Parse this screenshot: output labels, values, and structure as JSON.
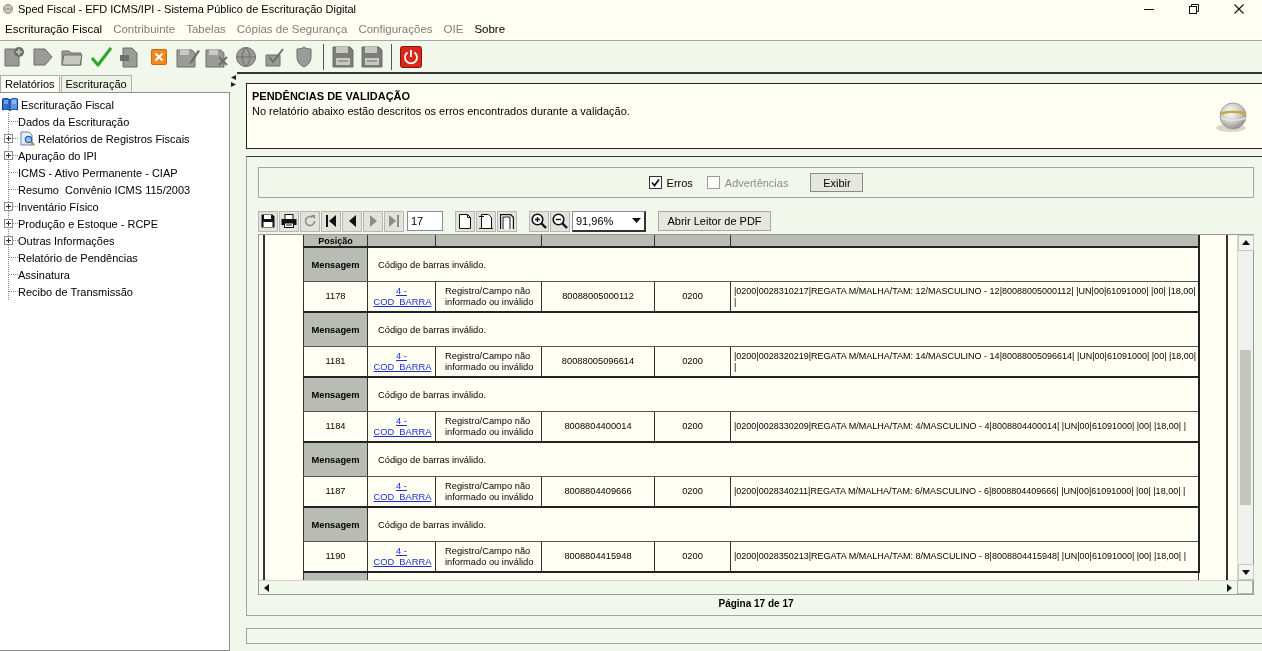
{
  "window": {
    "title": "Sped Fiscal - EFD ICMS/IPI - Sistema Público de Escrituração Digital"
  },
  "menu": [
    {
      "label": "Escrituração Fiscal",
      "disabled": false
    },
    {
      "label": "Contribuinte",
      "disabled": true
    },
    {
      "label": "Tabelas",
      "disabled": true
    },
    {
      "label": "Cópias de Segurança",
      "disabled": true
    },
    {
      "label": "Configurações",
      "disabled": true
    },
    {
      "label": "OIE",
      "disabled": true
    },
    {
      "label": "Sobre",
      "disabled": false
    }
  ],
  "toolbar": [
    {
      "buttons": [
        {
          "kind": "page-plus",
          "disabled": true
        },
        {
          "kind": "page-arrow",
          "disabled": true
        },
        {
          "kind": "folder",
          "disabled": true
        },
        {
          "kind": "check",
          "disabled": false
        },
        {
          "kind": "page",
          "disabled": true
        },
        {
          "kind": "x-box",
          "disabled": false
        },
        {
          "kind": "floppy-pen",
          "disabled": true
        },
        {
          "kind": "floppy-x",
          "disabled": true
        },
        {
          "kind": "globe",
          "disabled": true
        },
        {
          "kind": "tray-check",
          "disabled": true
        },
        {
          "kind": "shield",
          "disabled": true
        }
      ]
    },
    {
      "buttons": [
        {
          "kind": "floppy",
          "disabled": true
        },
        {
          "kind": "floppy",
          "disabled": true
        }
      ]
    },
    {
      "buttons": [
        {
          "kind": "power",
          "disabled": false
        }
      ]
    }
  ],
  "sidebar": {
    "tabs": [
      {
        "label": "Relatórios",
        "selected": true
      },
      {
        "label": "Escrituração",
        "selected": false
      }
    ],
    "tree": [
      {
        "label": "Escrituração Fiscal",
        "kind": "book",
        "children": [
          {
            "label": "Dados da Escrituração",
            "kind": "leaf"
          },
          {
            "label": "Relatórios de Registros Fiscais",
            "kind": "report",
            "expanded": false
          },
          {
            "label": "Apuração do IPI",
            "kind": "branch",
            "expanded": false
          },
          {
            "label": "ICMS - Ativo Permanente - CIAP",
            "kind": "leaf"
          },
          {
            "label": "Resumo  Convênio ICMS 115/2003",
            "kind": "leaf"
          },
          {
            "label": "Inventário Físico",
            "kind": "branch",
            "expanded": false
          },
          {
            "label": "Produção e Estoque - RCPE",
            "kind": "branch",
            "expanded": false
          },
          {
            "label": "Outras Informações",
            "kind": "branch",
            "expanded": false
          },
          {
            "label": "Relatório de Pendências",
            "kind": "leaf"
          },
          {
            "label": "Assinatura",
            "kind": "leaf"
          },
          {
            "label": "Recibo de Transmissão",
            "kind": "leaf"
          }
        ]
      }
    ]
  },
  "panel": {
    "title": "PENDÊNCIAS DE VALIDAÇÃO",
    "description": "No relatório abaixo estão descritos os erros encontrados durante a validação."
  },
  "filters": {
    "options": [
      {
        "label": "Erros",
        "checked": true,
        "disabled": false
      },
      {
        "label": "Advertências",
        "checked": false,
        "disabled": true
      }
    ],
    "button": "Exibir"
  },
  "viewer": {
    "toolbar": [
      {
        "kind": "save",
        "disabled": false
      },
      {
        "kind": "print",
        "disabled": false
      },
      {
        "kind": "refresh",
        "disabled": true
      },
      {
        "kind": "first",
        "disabled": false
      },
      {
        "kind": "previous",
        "disabled": false
      },
      {
        "kind": "next",
        "disabled": true
      },
      {
        "kind": "last",
        "disabled": true
      }
    ],
    "page": "17",
    "view_buttons": [
      {
        "kind": "single-page"
      },
      {
        "kind": "page-width"
      },
      {
        "kind": "page-fit"
      }
    ],
    "zoom_buttons": [
      {
        "kind": "zoom-in"
      },
      {
        "kind": "zoom-out"
      }
    ],
    "zoom": "91,96%",
    "pdf_button": "Abrir Leitor de PDF",
    "table": {
      "columns": [
        "Posição"
      ],
      "rows": [
        {
          "kind": "message",
          "label": "Mensagem",
          "text": "Código de barras inválido."
        },
        {
          "kind": "record",
          "cells": [
            "1178",
            "4 - COD_BARRA",
            "Registro/Campo não informado ou inválido",
            "80088005000112",
            "0200",
            "|0200|0028310217|REGATA M/MALHA/TAM: 12/MASCULINO - 12|80088005000112| |UN|00|61091000| |00| |18,00| |"
          ]
        },
        {
          "kind": "message",
          "label": "Mensagem",
          "text": "Código de barras inválido."
        },
        {
          "kind": "record",
          "cells": [
            "1181",
            "4 - COD_BARRA",
            "Registro/Campo não informado ou inválido",
            "80088005096614",
            "0200",
            "|0200|0028320219|REGATA M/MALHA/TAM: 14/MASCULINO - 14|80088005096614| |UN|00|61091000| |00| |18,00| |"
          ]
        },
        {
          "kind": "message",
          "label": "Mensagem",
          "text": "Código de barras inválido."
        },
        {
          "kind": "record",
          "cells": [
            "1184",
            "4 - COD_BARRA",
            "Registro/Campo não informado ou inválido",
            "8008804400014",
            "0200",
            "|0200|0028330209|REGATA M/MALHA/TAM: 4/MASCULINO - 4|8008804400014| |UN|00|61091000| |00| |18,00| |"
          ]
        },
        {
          "kind": "message",
          "label": "Mensagem",
          "text": "Código de barras inválido."
        },
        {
          "kind": "record",
          "cells": [
            "1187",
            "4 - COD_BARRA",
            "Registro/Campo não informado ou inválido",
            "8008804409666",
            "0200",
            "|0200|0028340211|REGATA M/MALHA/TAM: 6/MASCULINO - 6|8008804409666| |UN|00|61091000| |00| |18,00| |"
          ]
        },
        {
          "kind": "message",
          "label": "Mensagem",
          "text": "Código de barras inválido."
        },
        {
          "kind": "record",
          "cells": [
            "1190",
            "4 - COD_BARRA",
            "Registro/Campo não informado ou inválido",
            "8008804415948",
            "0200",
            "|0200|0028350213|REGATA M/MALHA/TAM: 8/MASCULINO - 8|8008804415948| |UN|00|61091000| |00| |18,00| |"
          ]
        }
      ]
    },
    "footer": "Página 17 de 17"
  }
}
